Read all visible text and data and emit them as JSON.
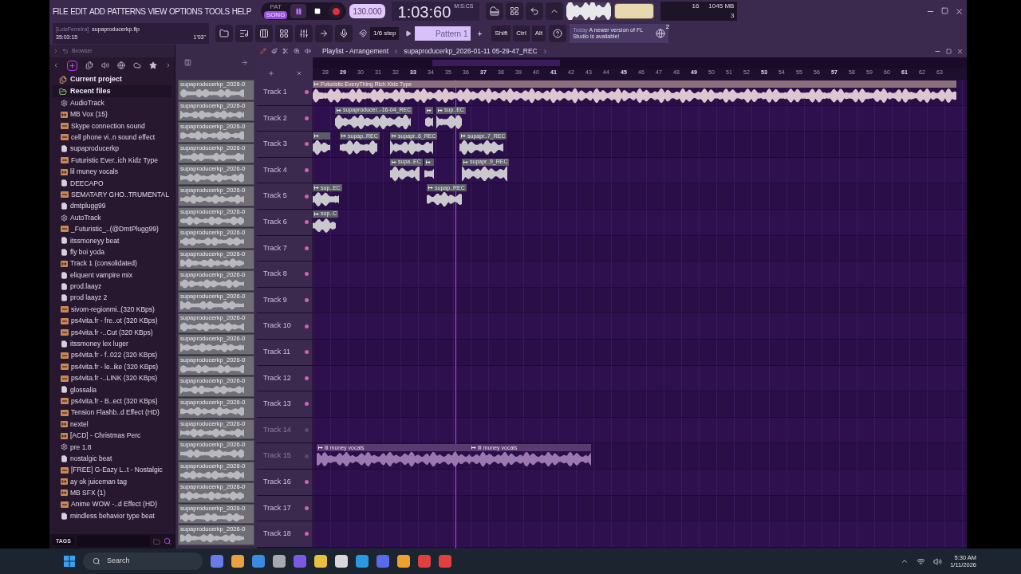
{
  "menu": [
    "FILE",
    "EDIT",
    "ADD",
    "PATTERNS",
    "VIEW",
    "OPTIONS",
    "TOOLS",
    "HELP"
  ],
  "transport": {
    "modes": [
      {
        "label": "PAT",
        "selected": false
      },
      {
        "label": "SONG",
        "selected": true
      }
    ],
    "tempo": "130.000",
    "time": "1:03:60",
    "time_unit": "M:S:CS"
  },
  "meters": {
    "readouts": [
      "16",
      "1045 MB",
      "3"
    ]
  },
  "project": {
    "user": "[LuisFerreira]",
    "file": "supaproducerkp.flp",
    "position": "35:03:15",
    "duration": "1'03\""
  },
  "step": "1/6 step",
  "pattern": {
    "name": "Pattern 1",
    "add": "+"
  },
  "modifiers": [
    "Shift",
    "Ctrl",
    "Alt"
  ],
  "news": {
    "day": "Today",
    "message": "A newer version of FL Studio is available!",
    "count": "2"
  },
  "browser": {
    "title": "Browser",
    "sections": [
      {
        "label": "Current project",
        "expanded": false
      },
      {
        "label": "Recent files",
        "expanded": true
      }
    ],
    "items": [
      {
        "label": "AudioTrack",
        "kind": "track"
      },
      {
        "label": "MB Vox (15)",
        "kind": "clip"
      },
      {
        "label": "Skype connection sound",
        "kind": "mp3"
      },
      {
        "label": "cell phone vi..n sound effect",
        "kind": "mp3"
      },
      {
        "label": "supaproducerkp",
        "kind": "file"
      },
      {
        "label": "Futuristic Ever..ich Kidz Type",
        "kind": "mp3"
      },
      {
        "label": "lil muney vocals",
        "kind": "clip"
      },
      {
        "label": "DEECAPO",
        "kind": "file"
      },
      {
        "label": "SEMATARY GHO..TRUMENTAL",
        "kind": "mp3"
      },
      {
        "label": "dmtplugg99",
        "kind": "file"
      },
      {
        "label": "AutoTrack",
        "kind": "track"
      },
      {
        "label": "_Futuristic_..(@DmtPlugg99)",
        "kind": "mp3"
      },
      {
        "label": "itssmoneyy beat",
        "kind": "file"
      },
      {
        "label": "fly boi yoda",
        "kind": "file"
      },
      {
        "label": "Track 1 (consolidated)",
        "kind": "clip"
      },
      {
        "label": "eliquent vampire mix",
        "kind": "file"
      },
      {
        "label": "prod.laayz",
        "kind": "file"
      },
      {
        "label": "prod laayz 2",
        "kind": "file"
      },
      {
        "label": "sivom-regionmi..(320 KBps)",
        "kind": "mp3"
      },
      {
        "label": "ps4vita.fr - fre..ot (320 KBps)",
        "kind": "mp3"
      },
      {
        "label": "ps4vita.fr -..Cut (320 KBps)",
        "kind": "mp3"
      },
      {
        "label": "itssmoney lex luger",
        "kind": "file"
      },
      {
        "label": "ps4vita.fr - f..022 (320 KBps)",
        "kind": "mp3"
      },
      {
        "label": "ps4vita.fr - le..ike (320 KBps)",
        "kind": "mp3"
      },
      {
        "label": "ps4vita.fr -..LINK (320 KBps)",
        "kind": "mp3"
      },
      {
        "label": "glossalia",
        "kind": "file"
      },
      {
        "label": "ps4vita.fr - B..ect (320 KBps)",
        "kind": "mp3"
      },
      {
        "label": "Tension Flashb..d Effect (HD)",
        "kind": "mp3"
      },
      {
        "label": "nextel",
        "kind": "clip"
      },
      {
        "label": "[ACD] - Christmas Perc",
        "kind": "clip"
      },
      {
        "label": "pre 1.8",
        "kind": "track"
      },
      {
        "label": "nostalgic beat",
        "kind": "file"
      },
      {
        "label": "[FREE] G-Eazy L..t - Nostalgic",
        "kind": "mp3"
      },
      {
        "label": "ay ok juiceman tag",
        "kind": "clip"
      },
      {
        "label": "MB SFX (1)",
        "kind": "clip"
      },
      {
        "label": "Anime WOW -..d Effect (HD)",
        "kind": "mp3"
      },
      {
        "label": "mindless behavior type beat",
        "kind": "file"
      }
    ],
    "tags_label": "TAGS"
  },
  "patterns": [
    "supaproducerkp_2026-0",
    "supaproducerkp_2026-0",
    "supaproducerkp_2026-0",
    "supaproducerkp_2026-0",
    "supaproducerkp_2026-0",
    "supaproducerkp_2026-0",
    "supaproducerkp_2026-0",
    "supaproducerkp_2026-0",
    "supaproducerkp_2026-0",
    "supaproducerkp_2026-0",
    "supaproducerkp_2026-0",
    "supaproducerkp_2026-0",
    "supaproducerkp_2026-0",
    "supaproducerkp_2026-0",
    "supaproducerkp_2026-0",
    "supaproducerkp_2026-0",
    "supaproducerkp_2026-0",
    "supaproducerkp_2026-0",
    "supaproducerkp_2026-0",
    "supaproducerkp_2026-0",
    "supaproducerkp_2026-0",
    "supaproducerkp_2026-0"
  ],
  "playlist": {
    "title": "Playlist - Arrangement",
    "path": "supaproducerkp_2026-01-11 05-29-47_REC",
    "ruler": [
      "28",
      "29",
      "30",
      "31",
      "32",
      "33",
      "34",
      "35",
      "36",
      "37",
      "38",
      "39",
      "40",
      "41",
      "42",
      "43",
      "44",
      "45",
      "46",
      "47",
      "48",
      "49",
      "50",
      "51",
      "52",
      "53",
      "54",
      "55",
      "56",
      "57",
      "58",
      "59",
      "60",
      "61",
      "62",
      "63"
    ],
    "tracks": [
      {
        "name": "Track 1",
        "muted": false,
        "clips": [
          {
            "name": "Futuristic EveryThing Rich Kidz Type",
            "color": "#dcc6cf"
          }
        ]
      },
      {
        "name": "Track 2",
        "muted": false,
        "clips": [
          {
            "name": "supaproducer..-16-04_REC",
            "color": "#c9c9cd"
          },
          {
            "color": "#c9c9cd"
          },
          {
            "name": "sup..EC",
            "color": "#c9c9cd"
          }
        ]
      },
      {
        "name": "Track 3",
        "muted": false,
        "clips": [
          {
            "color": "#c9c9cd"
          },
          {
            "name": "supap..REC",
            "color": "#c9c9cd"
          },
          {
            "name": "supapr..6_REC",
            "color": "#c9c9cd"
          },
          {
            "name": "supapr..7_REC",
            "color": "#c9c9cd"
          }
        ]
      },
      {
        "name": "Track 4",
        "muted": false,
        "clips": [
          {
            "name": "supa..EC",
            "color": "#c9c9cd"
          },
          {
            "color": "#c9c9cd"
          },
          {
            "name": "supapr..9_REC",
            "color": "#c9c9cd"
          }
        ]
      },
      {
        "name": "Track 5",
        "muted": false,
        "clips": [
          {
            "name": "sup..EC",
            "color": "#c9c9cd"
          },
          {
            "name": "supap..REC",
            "color": "#c9c9cd"
          }
        ]
      },
      {
        "name": "Track 6",
        "muted": false,
        "clips": [
          {
            "name": "sup..C",
            "color": "#c9c9cd"
          }
        ]
      },
      {
        "name": "Track 7",
        "muted": false
      },
      {
        "name": "Track 8",
        "muted": false
      },
      {
        "name": "Track 9",
        "muted": false
      },
      {
        "name": "Track 10",
        "muted": false
      },
      {
        "name": "Track 11",
        "muted": false
      },
      {
        "name": "Track 12",
        "muted": false
      },
      {
        "name": "Track 13",
        "muted": false
      },
      {
        "name": "Track 14",
        "muted": true
      },
      {
        "name": "Track 15",
        "muted": true,
        "clips": [
          {
            "name": "lil muney vocals",
            "color": "#9b78b0"
          },
          {
            "name": "lil muney vocals",
            "color": "#9b78b0"
          }
        ]
      },
      {
        "name": "Track 16",
        "muted": false
      },
      {
        "name": "Track 17",
        "muted": false
      },
      {
        "name": "Track 18",
        "muted": false
      }
    ]
  },
  "taskbar": {
    "search": "Search",
    "time": "5:30 AM",
    "date": "1/11/2026"
  }
}
